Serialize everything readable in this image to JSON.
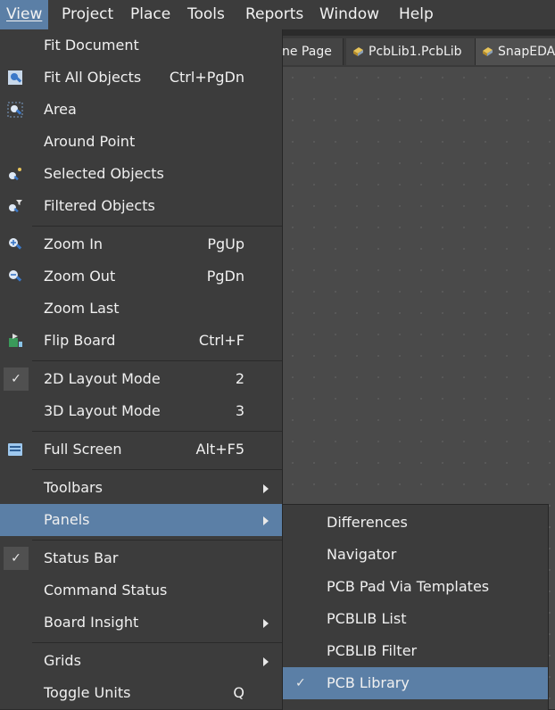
{
  "menubar": [
    {
      "name": "menu-view",
      "label": "View",
      "active": true
    },
    {
      "name": "menu-project",
      "label": "Project"
    },
    {
      "name": "menu-place",
      "label": "Place"
    },
    {
      "name": "menu-tools",
      "label": "Tools"
    },
    {
      "name": "menu-reports",
      "label": "Reports"
    },
    {
      "name": "menu-window",
      "label": "Window"
    },
    {
      "name": "menu-help",
      "label": "Help"
    }
  ],
  "tabs": [
    {
      "label": "ne Page"
    },
    {
      "label": "PcbLib1.PcbLib"
    },
    {
      "label": "SnapEDA"
    }
  ],
  "view_menu": [
    {
      "label": "Fit Document",
      "shortcut": "",
      "icon": ""
    },
    {
      "label": "Fit All Objects",
      "shortcut": "Ctrl+PgDn",
      "icon": "fit-all-objects-icon"
    },
    {
      "label": "Area",
      "shortcut": "",
      "icon": "zoom-area-icon"
    },
    {
      "label": "Around Point",
      "shortcut": "",
      "icon": ""
    },
    {
      "label": "Selected Objects",
      "shortcut": "",
      "icon": "selected-objects-icon"
    },
    {
      "label": "Filtered Objects",
      "shortcut": "",
      "icon": "filtered-objects-icon"
    },
    {
      "label": "Zoom In",
      "shortcut": "PgUp",
      "icon": "zoom-in-icon"
    },
    {
      "label": "Zoom Out",
      "shortcut": "PgDn",
      "icon": "zoom-out-icon"
    },
    {
      "label": "Zoom Last",
      "shortcut": "",
      "icon": ""
    },
    {
      "label": "Flip Board",
      "shortcut": "Ctrl+F",
      "icon": "flip-board-icon"
    },
    {
      "label": "2D Layout Mode",
      "shortcut": "2",
      "checked": true
    },
    {
      "label": "3D Layout Mode",
      "shortcut": "3"
    },
    {
      "label": "Full Screen",
      "shortcut": "Alt+F5",
      "icon": "full-screen-icon"
    },
    {
      "label": "Toolbars",
      "submenu": true
    },
    {
      "label": "Panels",
      "submenu": true,
      "highlighted": true
    },
    {
      "label": "Status Bar",
      "checked": true
    },
    {
      "label": "Command Status"
    },
    {
      "label": "Board Insight",
      "submenu": true
    },
    {
      "label": "Grids",
      "submenu": true
    },
    {
      "label": "Toggle Units",
      "shortcut": "Q"
    }
  ],
  "panels_submenu": [
    {
      "label": "Differences"
    },
    {
      "label": "Navigator"
    },
    {
      "label": "PCB Pad Via Templates"
    },
    {
      "label": "PCBLIB List"
    },
    {
      "label": "PCBLIB Filter"
    },
    {
      "label": "PCB Library",
      "checked": true,
      "highlighted": true
    }
  ],
  "colors": {
    "menu_bg": "#3c3c3c",
    "highlight": "#5b7fa6",
    "canvas": "#4a4a4a"
  }
}
